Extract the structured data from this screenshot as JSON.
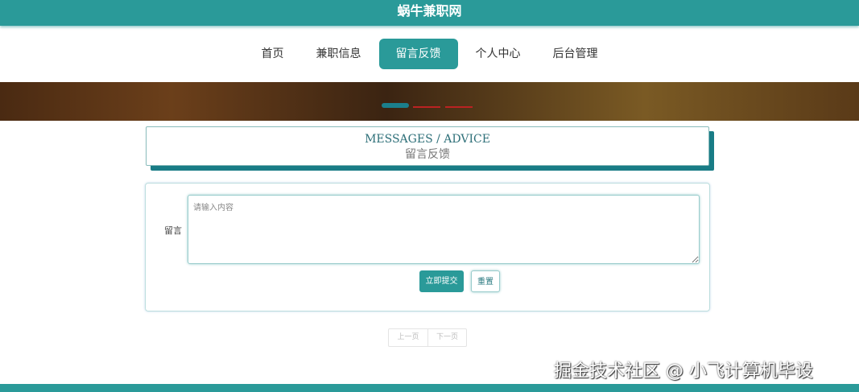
{
  "site_title": "蜗牛兼职网",
  "nav": [
    {
      "label": "首页"
    },
    {
      "label": "兼职信息"
    },
    {
      "label": "留言反馈"
    },
    {
      "label": "个人中心"
    },
    {
      "label": "后台管理"
    }
  ],
  "page_title": {
    "en": "MESSAGES / ADVICE",
    "cn": "留言反馈"
  },
  "form": {
    "label": "留言",
    "placeholder": "请输入内容",
    "submit": "立即提交",
    "reset": "重置"
  },
  "pager": {
    "prev": "上一页",
    "next": "下一页"
  },
  "watermark": "掘金技术社区 @ 小飞计算机毕设",
  "colors": {
    "primary": "#2a9a99"
  }
}
